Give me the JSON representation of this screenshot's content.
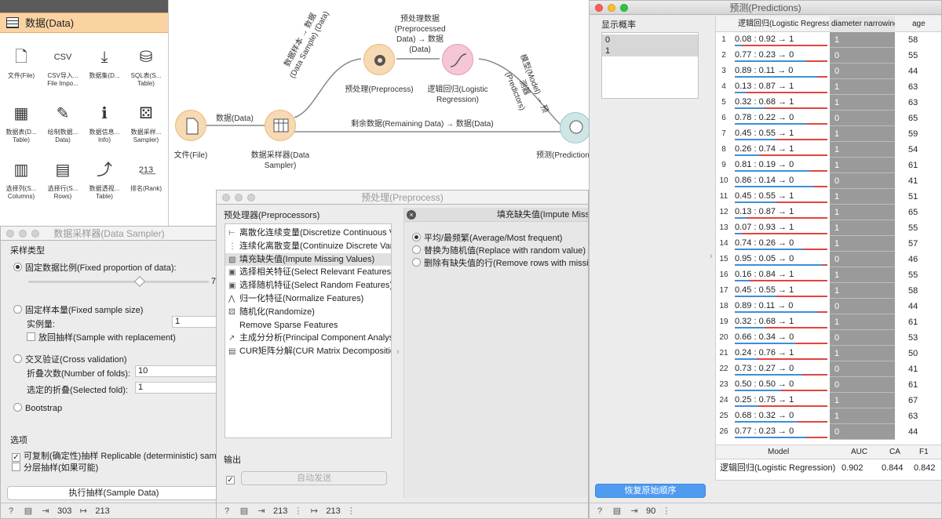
{
  "canvas": {
    "nodes": {
      "file": "文件(File)",
      "sampler": "数据采样器(Data\nSampler)",
      "preprocess": "预处理(Preprocess)",
      "logreg": "逻辑回归(Logistic\nRegression)",
      "predictions": "预测(Predictions)"
    },
    "links": {
      "data": "数据(Data)",
      "sample": "数据样本 → 数据\n(Data Sample) (Data)",
      "preprocessed": "预处理数据\n(Preprocessed\nData) → 数据\n(Data)",
      "remaining": "剩余数据(Remaining Data) → 数据(Data)",
      "model": "模型(Model) → 预测器\n(Predictors)"
    }
  },
  "toolbox": {
    "category": "数据(Data)",
    "widgets": [
      {
        "label": "文件(File)",
        "icon": "file-icon"
      },
      {
        "label": "CSV导入...\nFile Impo...",
        "icon": "csv-icon"
      },
      {
        "label": "数据集(D...",
        "icon": "download-icon"
      },
      {
        "label": "SQL表(S...\nTable)",
        "icon": "database-icon"
      },
      {
        "label": "数据表(D...\nTable)",
        "icon": "table-icon"
      },
      {
        "label": "绘制数据...\nData)",
        "icon": "paint-icon"
      },
      {
        "label": "数据信息...\nInfo)",
        "icon": "info-icon"
      },
      {
        "label": "数据采样...\nSampler)",
        "icon": "dice-icon"
      },
      {
        "label": "选择列(S...\nColumns)",
        "icon": "select-columns-icon"
      },
      {
        "label": "选择行(S...\nRows)",
        "icon": "select-rows-icon"
      },
      {
        "label": "数据透视...\nTable)",
        "icon": "pivot-icon"
      },
      {
        "label": "排名(Rank)",
        "icon": "rank-icon"
      }
    ]
  },
  "sampler": {
    "title": "数据采样器(Data Sampler)",
    "section": "采样类型",
    "opt_fixed_prop": "固定数据比例(Fixed proportion of data):",
    "slider_value": "7",
    "slider_fraction": 0.7,
    "opt_fixed_size": "固定样本量(Fixed sample size)",
    "instances_label": "实例量:",
    "instances_value": "1",
    "replacement": "放回抽样(Sample with replacement)",
    "opt_cv": "交叉验证(Cross validation)",
    "folds_label": "折叠次数(Number of folds):",
    "folds_value": "10",
    "selected_fold_label": "选定的折叠(Selected fold):",
    "selected_fold_value": "1",
    "opt_bootstrap": "Bootstrap",
    "options_label": "选项",
    "replicable": "可复制(确定性)抽样 Replicable (deterministic) sam",
    "stratify": "分层抽样(如果可能)",
    "sample_button": "执行抽样(Sample Data)",
    "status_in": "303",
    "status_out": "213"
  },
  "preprocess": {
    "title": "预处理(Preprocess)",
    "preprocessors_label": "预处理器(Preprocessors)",
    "items": [
      {
        "label": "离散化连续变量(Discretize Continuous Va",
        "icon": "discretize-icon"
      },
      {
        "label": "连续化离散变量(Continuize Discrete Varia",
        "icon": "continuize-icon"
      },
      {
        "label": "填充缺失值(Impute Missing Values)",
        "icon": "impute-icon"
      },
      {
        "label": "选择相关特征(Select Relevant Features)",
        "icon": "select-relevant-icon"
      },
      {
        "label": "选择随机特征(Select Random Features)",
        "icon": "select-random-icon"
      },
      {
        "label": "归一化特征(Normalize Features)",
        "icon": "normalize-icon"
      },
      {
        "label": "随机化(Randomize)",
        "icon": "randomize-icon"
      },
      {
        "label": "Remove Sparse Features",
        "icon": "sparse-icon"
      },
      {
        "label": "主成分分析(Principal Component Analysi",
        "icon": "pca-icon"
      },
      {
        "label": "CUR矩阵分解(CUR Matrix Decompositio",
        "icon": "cur-icon"
      }
    ],
    "panel_title": "填充缺失值(Impute Missing",
    "panel_opts": [
      "平均/最频繁(Average/Most frequent)",
      "替换为随机值(Replace with random value)",
      "删除有缺失值的行(Remove rows with missi"
    ],
    "output_label": "输出",
    "auto_send": "自动发送",
    "status_in": "213",
    "status_out": "213"
  },
  "predictions": {
    "title": "预测(Predictions)",
    "show_prob_label": "显示概率",
    "classes": [
      "0",
      "1"
    ],
    "columns": [
      "逻辑回归(Logistic Regressio",
      "diameter narrowing",
      "age"
    ],
    "rows": [
      {
        "n": "1",
        "p": "0.08 : 0.92 → 1",
        "d": "1",
        "a": "58",
        "c": "1"
      },
      {
        "n": "2",
        "p": "0.77 : 0.23 → 0",
        "d": "0",
        "a": "55",
        "c": "0"
      },
      {
        "n": "3",
        "p": "0.89 : 0.11 → 0",
        "d": "0",
        "a": "44",
        "c": "0"
      },
      {
        "n": "4",
        "p": "0.13 : 0.87 → 1",
        "d": "1",
        "a": "63",
        "c": "1"
      },
      {
        "n": "5",
        "p": "0.32 : 0.68 → 1",
        "d": "1",
        "a": "63",
        "c": "1"
      },
      {
        "n": "6",
        "p": "0.78 : 0.22 → 0",
        "d": "0",
        "a": "65",
        "c": "0"
      },
      {
        "n": "7",
        "p": "0.45 : 0.55 → 1",
        "d": "1",
        "a": "59",
        "c": "1"
      },
      {
        "n": "8",
        "p": "0.26 : 0.74 → 1",
        "d": "1",
        "a": "54",
        "c": "1"
      },
      {
        "n": "9",
        "p": "0.81 : 0.19 → 0",
        "d": "1",
        "a": "61",
        "c": "0"
      },
      {
        "n": "10",
        "p": "0.86 : 0.14 → 0",
        "d": "0",
        "a": "41",
        "c": "0"
      },
      {
        "n": "11",
        "p": "0.45 : 0.55 → 1",
        "d": "1",
        "a": "51",
        "c": "1"
      },
      {
        "n": "12",
        "p": "0.13 : 0.87 → 1",
        "d": "1",
        "a": "65",
        "c": "1"
      },
      {
        "n": "13",
        "p": "0.07 : 0.93 → 1",
        "d": "1",
        "a": "55",
        "c": "1"
      },
      {
        "n": "14",
        "p": "0.74 : 0.26 → 0",
        "d": "1",
        "a": "57",
        "c": "0"
      },
      {
        "n": "15",
        "p": "0.95 : 0.05 → 0",
        "d": "0",
        "a": "46",
        "c": "0"
      },
      {
        "n": "16",
        "p": "0.16 : 0.84 → 1",
        "d": "1",
        "a": "55",
        "c": "1"
      },
      {
        "n": "17",
        "p": "0.45 : 0.55 → 1",
        "d": "1",
        "a": "58",
        "c": "1"
      },
      {
        "n": "18",
        "p": "0.89 : 0.11 → 0",
        "d": "0",
        "a": "44",
        "c": "0"
      },
      {
        "n": "19",
        "p": "0.32 : 0.68 → 1",
        "d": "1",
        "a": "61",
        "c": "1"
      },
      {
        "n": "20",
        "p": "0.66 : 0.34 → 0",
        "d": "0",
        "a": "53",
        "c": "0"
      },
      {
        "n": "21",
        "p": "0.24 : 0.76 → 1",
        "d": "1",
        "a": "50",
        "c": "1"
      },
      {
        "n": "22",
        "p": "0.73 : 0.27 → 0",
        "d": "0",
        "a": "41",
        "c": "0"
      },
      {
        "n": "23",
        "p": "0.50 : 0.50 → 0",
        "d": "0",
        "a": "61",
        "c": "0"
      },
      {
        "n": "24",
        "p": "0.25 : 0.75 → 1",
        "d": "1",
        "a": "67",
        "c": "1"
      },
      {
        "n": "25",
        "p": "0.68 : 0.32 → 0",
        "d": "1",
        "a": "63",
        "c": "0"
      },
      {
        "n": "26",
        "p": "0.77 : 0.23 → 0",
        "d": "0",
        "a": "44",
        "c": "0"
      }
    ],
    "eval_headers": [
      "Model",
      "AUC",
      "CA",
      "F1"
    ],
    "eval_row": [
      "逻辑回归(Logistic Regression)",
      "0.902",
      "0.844",
      "0.842"
    ],
    "restore_button": "恢复原始顺序",
    "status_in": "90",
    "colors": {
      "class0": "#3d8fd6",
      "class1": "#e0453f",
      "target_bg": "#9a9a9a",
      "restore_btn": "#4f9bf0"
    }
  }
}
